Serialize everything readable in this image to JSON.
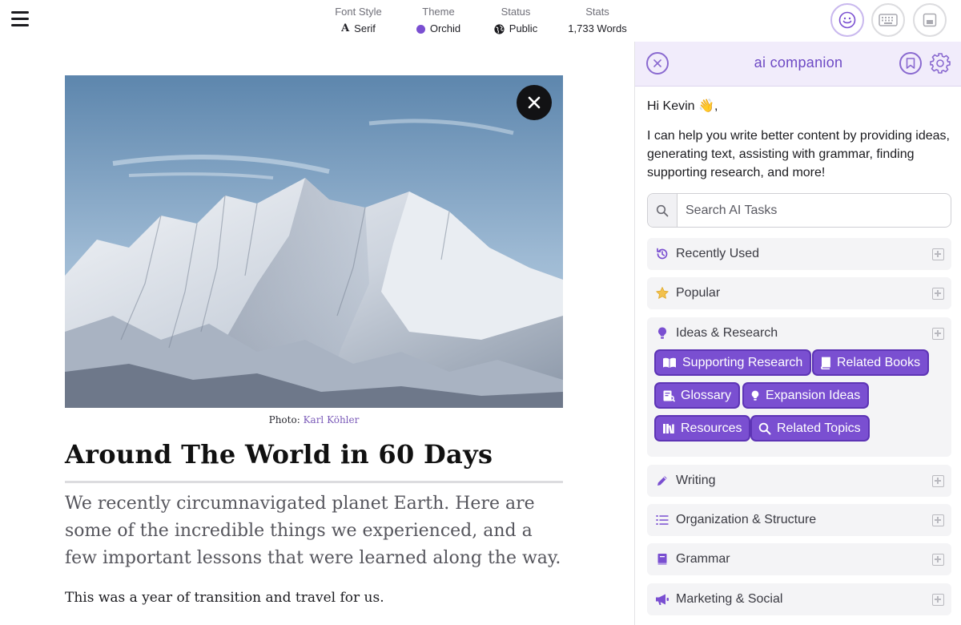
{
  "header": {
    "stats": [
      {
        "label": "Font Style",
        "value": "Serif",
        "icon": "serif-a-icon"
      },
      {
        "label": "Theme",
        "value": "Orchid",
        "icon": "color-dot-icon",
        "color": "#7a4fd1"
      },
      {
        "label": "Status",
        "value": "Public",
        "icon": "globe-icon"
      },
      {
        "label": "Stats",
        "value": "1,733 Words"
      }
    ],
    "tools": [
      "smiley-icon",
      "keyboard-icon",
      "save-icon"
    ]
  },
  "article": {
    "photo_prefix": "Photo:",
    "photo_credit": "Karl Köhler",
    "title": "Around The World in 60 Days",
    "lede": "We recently circumnavigated planet Earth. Here are some of the incredible things we experienced, and a few important lessons that were learned along the way.",
    "body": "This was a year of transition and travel for us."
  },
  "companion": {
    "title": "ai companion",
    "greeting": "Hi Kevin 👋,",
    "intro": "I can help you write better content by providing ideas, generating text, assisting with grammar, finding supporting research, and more!",
    "search_placeholder": "Search AI Tasks",
    "categories": [
      {
        "label": "Recently Used",
        "icon": "history-icon"
      },
      {
        "label": "Popular",
        "icon": "star-icon"
      },
      {
        "label": "Ideas & Research",
        "icon": "lightbulb-icon",
        "expanded": true,
        "items": [
          "Supporting Research",
          "Related Books",
          "Glossary",
          "Expansion Ideas",
          "Resources",
          "Related Topics"
        ]
      },
      {
        "label": "Writing",
        "icon": "pencil-icon"
      },
      {
        "label": "Organization & Structure",
        "icon": "list-icon"
      },
      {
        "label": "Grammar",
        "icon": "book-icon"
      },
      {
        "label": "Marketing & Social",
        "icon": "megaphone-icon"
      }
    ]
  },
  "colors": {
    "accent": "#7a4fd1",
    "accent_dark": "#5d34b5",
    "panel_header": "#f1ecfb"
  }
}
